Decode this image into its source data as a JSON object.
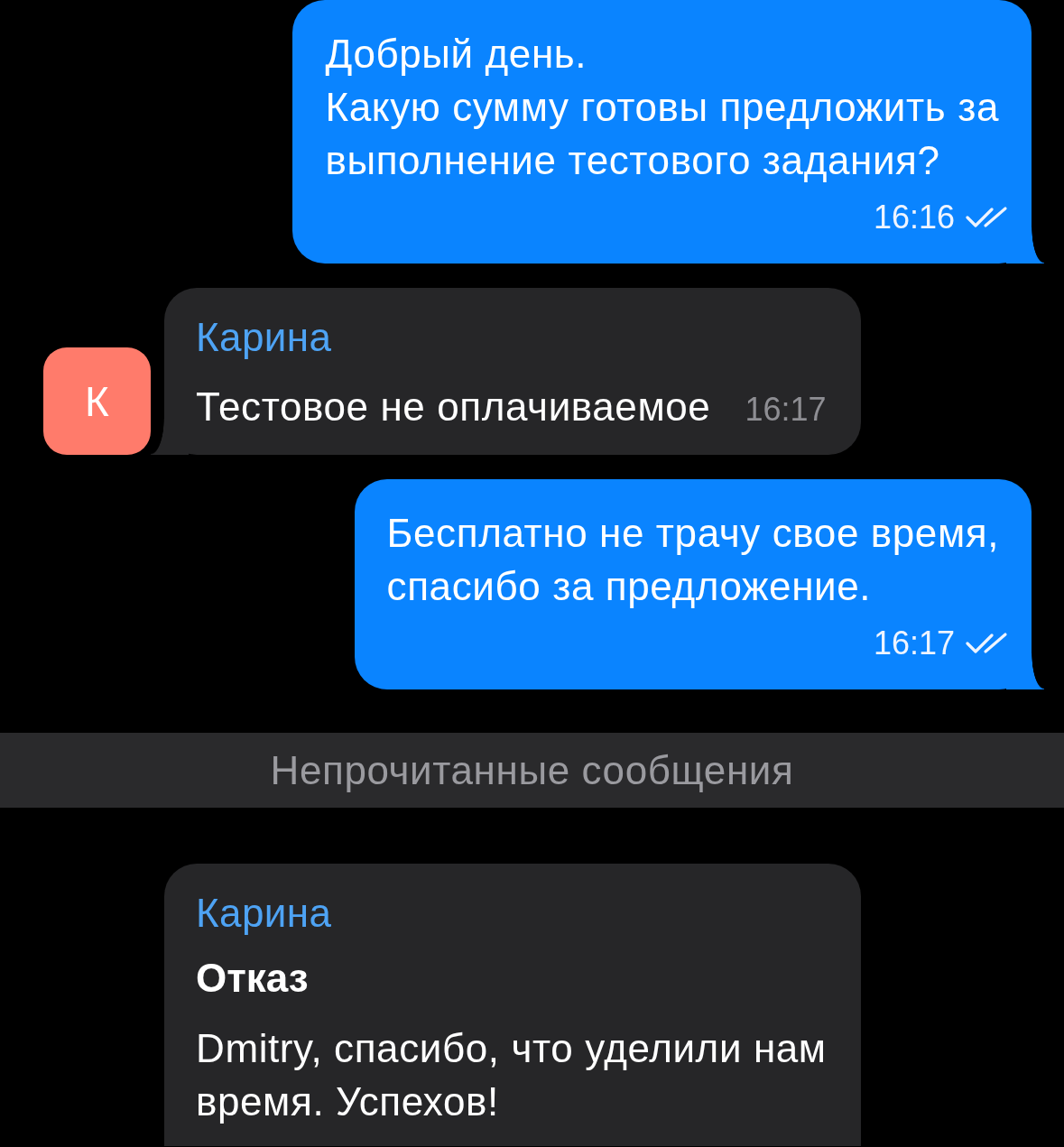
{
  "messages": [
    {
      "kind": "outgoing",
      "text": "Добрый день.\nКакую сумму готовы предложить за\nвыполнение тестового задания?",
      "time": "16:16",
      "read": true,
      "tail": true
    },
    {
      "kind": "incoming",
      "avatar": "К",
      "sender": "Карина",
      "text": "Тестовое не оплачиваемое",
      "time": "16:17",
      "tail": true
    },
    {
      "kind": "outgoing",
      "text": "Бесплатно не трачу свое время,\nспасибо за предложение.",
      "time": "16:17",
      "read": true,
      "tail": true
    },
    {
      "kind": "divider",
      "text": "Непрочитанные сообщения"
    },
    {
      "kind": "incoming",
      "sender": "Карина",
      "title": "Отказ",
      "text": "Dmitry, спасибо, что уделили нам\nвремя. Успехов!",
      "tail": false
    }
  ]
}
